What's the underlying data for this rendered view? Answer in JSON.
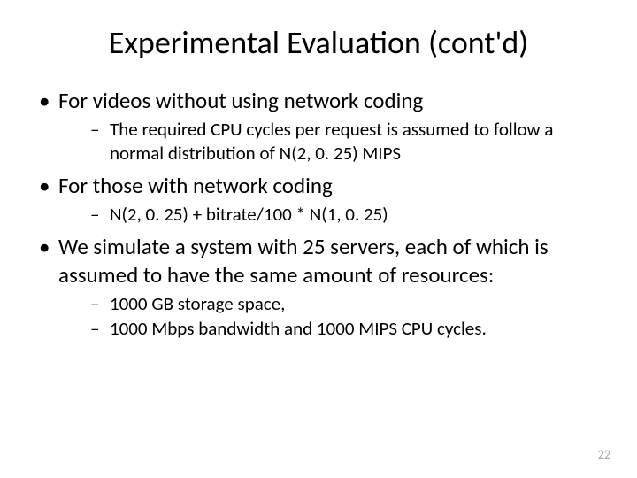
{
  "title": "Experimental Evaluation (cont'd)",
  "bullets": [
    {
      "text": "For videos without using network coding",
      "sub": [
        "The required CPU cycles per request is assumed to follow a normal distribution of N(2, 0. 25) MIPS"
      ]
    },
    {
      "text": "For those with network coding",
      "sub": [
        "N(2, 0. 25) + bitrate/100 * N(1, 0. 25)"
      ]
    },
    {
      "text": "We simulate a system with 25 servers, each of which is assumed to have the same amount of resources:",
      "sub": [
        "1000 GB storage space,",
        "1000 Mbps bandwidth and 1000 MIPS CPU cycles."
      ]
    }
  ],
  "pageNumber": "22"
}
